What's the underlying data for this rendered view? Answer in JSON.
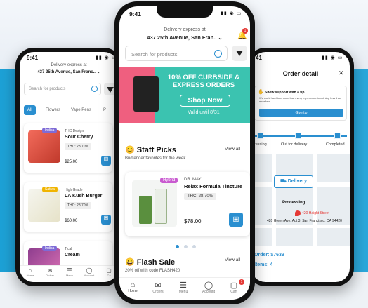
{
  "colors": {
    "accent": "#2a8fd0",
    "indica": "#7e6bd6",
    "sativa": "#f0b400",
    "hybrid": "#c95bd0",
    "banner_teal": "#3bc3b0",
    "banner_pink": "#ef5f7f",
    "alert": "#e53935"
  },
  "left_phone": {
    "time": "9:41",
    "delivery_label": "Delivery express at",
    "address": "437 25th Avenue, San Franc.. ⌄",
    "search_placeholder": "Search for products",
    "tabs": [
      "All",
      "Flowers",
      "Vape Pens",
      "P"
    ],
    "products": [
      {
        "badge": "Indica",
        "brand": "THC Design",
        "name": "Sour Cherry",
        "thc": "THC: 28.70%",
        "price": "$25.00"
      },
      {
        "badge": "Sativa",
        "brand": "High Grade",
        "name": "LA Kush Burger",
        "thc": "THC: 28.70%",
        "price": "$60.00"
      },
      {
        "badge": "Indica",
        "brand": "Tical",
        "name": "Cream",
        "thc": "",
        "price": ""
      }
    ],
    "nav": [
      {
        "icon": "home-icon",
        "label": "Home"
      },
      {
        "icon": "orders-icon",
        "label": "Orders"
      },
      {
        "icon": "menu-icon",
        "label": "Menu"
      },
      {
        "icon": "account-icon",
        "label": "Account"
      },
      {
        "icon": "cart-icon",
        "label": "Ca"
      }
    ]
  },
  "center_phone": {
    "time": "9:41",
    "delivery_label": "Delivery express at",
    "address": "437 25th Avenue, San Fran.. ⌄",
    "notification_count": "1",
    "search_placeholder": "Search for products",
    "banner": {
      "headline": "10% OFF CURBSIDE & EXPRESS ORDERS",
      "button": "Shop Now",
      "valid": "Valid until 8/31"
    },
    "staff_picks": {
      "title": "😊 Staff Picks",
      "subtitle": "Budtender favorites for the week",
      "view_all": "View all"
    },
    "product": {
      "badge": "Hybrid",
      "brand": "DR. MAY",
      "name": "Relax Formula Tincture",
      "thc": "THC: 28.70%",
      "price": "$78.00"
    },
    "flash_sale": {
      "title": "😀 Flash Sale",
      "subtitle": "20% off with code FLASH420",
      "view_all": "View all"
    },
    "carousel_active_index": 0,
    "nav": [
      {
        "icon": "home-icon",
        "label": "Home"
      },
      {
        "icon": "orders-icon",
        "label": "Orders"
      },
      {
        "icon": "menu-icon",
        "label": "Menu"
      },
      {
        "icon": "account-icon",
        "label": "Account"
      },
      {
        "icon": "cart-icon",
        "label": "Cart"
      }
    ],
    "cart_count": "1"
  },
  "right_phone": {
    "time": "41",
    "title": "Order detail",
    "support_title": "Show support with a tip",
    "support_text": "We work hard to ensure that every experience is nothing less than excellent.",
    "give_tip": "Give tip",
    "steps": [
      "ocessing",
      "Out for delivery",
      "Completed"
    ],
    "delivery_button": "Delivery",
    "processing": "Processing",
    "map_place": "420 Haight Street",
    "map_address": "420 Green Ave, Apt 3, San Francisco, CA 94420",
    "order_label": "Order: $7639",
    "items_label": "Items: 4"
  }
}
